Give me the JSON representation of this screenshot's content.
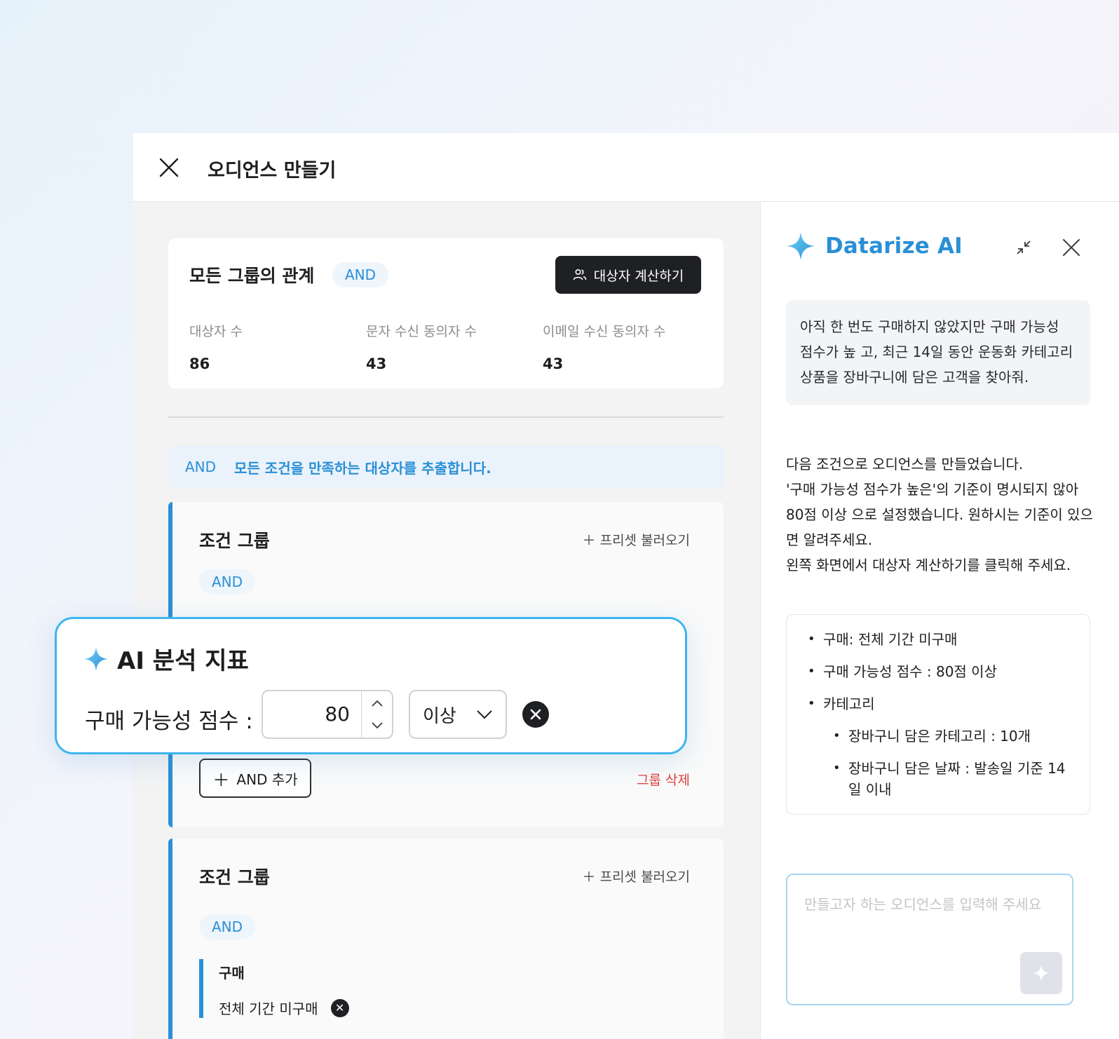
{
  "window": {
    "title": "오디언스 만들기"
  },
  "summary": {
    "title": "모든 그룹의 관계",
    "relation": "AND",
    "calc_button": "대상자 계산하기",
    "stats": [
      {
        "label": "대상자 수",
        "value": "86"
      },
      {
        "label": "문자 수신 동의자 수",
        "value": "43"
      },
      {
        "label": "이메일 수신 동의자 수",
        "value": "43"
      }
    ]
  },
  "info_bar": {
    "operator": "AND",
    "text": "모든 조건을 만족하는 대상자를 추출합니다."
  },
  "groups": [
    {
      "title": "조건 그룹",
      "preset": "프리셋 불러오기",
      "operator": "AND",
      "add_button": "AND 추가",
      "delete": "그룹 삭제"
    },
    {
      "title": "조건 그룹",
      "preset": "프리셋 불러오기",
      "operator": "AND",
      "condition": {
        "title": "구매",
        "value": "전체 기간 미구매"
      }
    }
  ],
  "float_card": {
    "title": "AI 분석 지표",
    "label": "구매 가능성 점수 :",
    "value": "80",
    "comparator": "이상"
  },
  "ai_panel": {
    "brand": "Datarize",
    "brand_suffix": "AI",
    "user_message": "아직 한 번도 구매하지 않았지만 구매 가능성 점수가 높 고, 최근 14일 동안 운동화 카테고리 상품을 장바구니에 담은 고객을 찾아줘.",
    "ai_lines": [
      "다음 조건으로 오디언스를 만들었습니다.",
      "'구매 가능성 점수가 높은'의 기준이 명시되지 않아 80점 이상 으로 설정했습니다. 원하시는 기준이 있으면 알려주세요.",
      "왼쪽 화면에서 대상자 계산하기를 클릭해 주세요."
    ],
    "summary_items": [
      "구매: 전체 기간 미구매",
      "구매 가능성 점수 : 80점 이상",
      "카테고리"
    ],
    "summary_sub_items": [
      "장바구니 담은 카테고리 : 10개",
      "장바구니 담은 날짜 : 발송일 기준 14일 이내"
    ],
    "input_placeholder": "만들고자 하는 오디언스를 입력해 주세요"
  },
  "colors": {
    "accent": "#2b8fd6",
    "danger": "#e04343",
    "dark": "#1f2023"
  }
}
